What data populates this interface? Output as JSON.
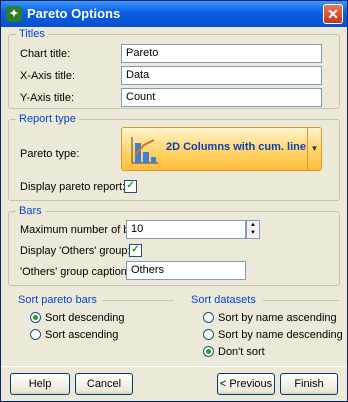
{
  "window": {
    "title": "Pareto Options"
  },
  "titles": {
    "legend": "Titles",
    "chart_title_label": "Chart title:",
    "chart_title_value": "Pareto",
    "xaxis_label": "X-Axis title:",
    "xaxis_value": "Data",
    "yaxis_label": "Y-Axis title:",
    "yaxis_value": "Count"
  },
  "report": {
    "legend": "Report type",
    "pareto_type_label": "Pareto type:",
    "pareto_type_value": "2D Columns with cum. line",
    "display_report_label": "Display pareto report:",
    "display_report_checked": true
  },
  "bars": {
    "legend": "Bars",
    "max_bars_label": "Maximum number of bars:",
    "max_bars_value": "10",
    "display_others_label": "Display 'Others' group:",
    "display_others_checked": true,
    "others_caption_label": "'Others' group caption:",
    "others_caption_value": "Others"
  },
  "sort_bars": {
    "heading": "Sort pareto bars",
    "options": [
      "Sort descending",
      "Sort ascending"
    ],
    "selected": "Sort descending"
  },
  "sort_datasets": {
    "heading": "Sort datasets",
    "options": [
      "Sort by name ascending",
      "Sort by name descending",
      "Don't sort"
    ],
    "selected": "Don't sort"
  },
  "buttons": {
    "help": "Help",
    "cancel": "Cancel",
    "previous": "< Previous",
    "finish": "Finish"
  }
}
